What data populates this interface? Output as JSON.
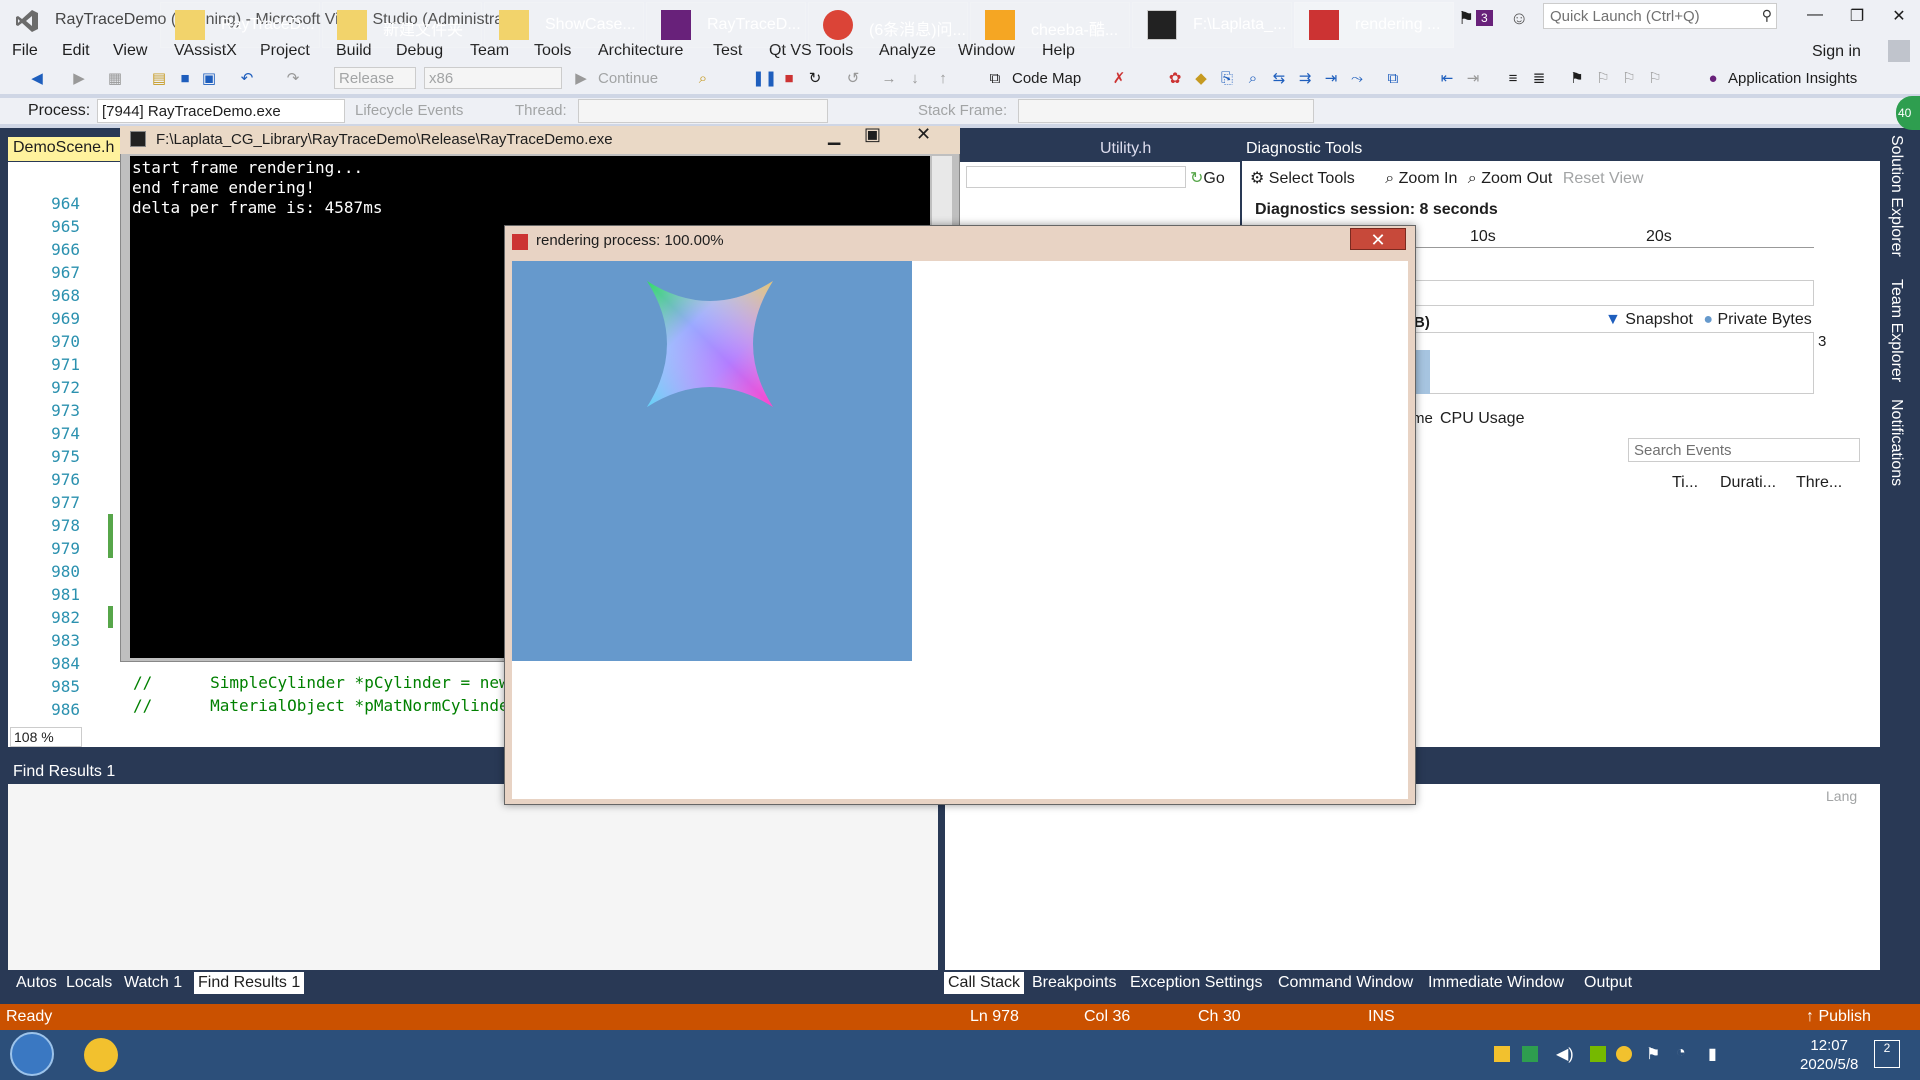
{
  "window": {
    "title": "RayTraceDemo (Running) - Microsoft Visual Studio (Administrator)",
    "notification_count": "3",
    "quick_launch_placeholder": "Quick Launch (Ctrl+Q)",
    "sign_in": "Sign in"
  },
  "menu": [
    "File",
    "Edit",
    "View",
    "VAssistX",
    "Project",
    "Build",
    "Debug",
    "Team",
    "Tools",
    "Architecture",
    "Test",
    "Qt VS Tools",
    "Analyze",
    "Window",
    "Help"
  ],
  "toolbar": {
    "config": "Release",
    "platform": "x86",
    "continue": "Continue",
    "code_map": "Code Map",
    "app_insights": "Application Insights"
  },
  "debugbar": {
    "process_label": "Process:",
    "process_value": "[7944] RayTraceDemo.exe",
    "lifecycle": "Lifecycle Events",
    "thread_label": "Thread:",
    "stack_frame": "Stack Frame:"
  },
  "editor": {
    "tab": "DemoScene.h",
    "utility_tab": "Utility.h",
    "go": "Go",
    "zoom": "108 %",
    "line_numbers": [
      "964",
      "965",
      "966",
      "967",
      "968",
      "969",
      "970",
      "971",
      "972",
      "973",
      "974",
      "975",
      "976",
      "977",
      "978",
      "979",
      "980",
      "981",
      "982",
      "983",
      "984",
      "985",
      "986"
    ],
    "code_985": "//      SimpleCylinder *pCylinder = new",
    "code_986": "//      MaterialObject *pMatNormCylinde"
  },
  "diagnostics": {
    "title": "Diagnostic Tools",
    "select_tools": "Select Tools",
    "zoom_in": "Zoom In",
    "zoom_out": "Zoom Out",
    "reset_view": "Reset View",
    "session": "Diagnostics session: 8 seconds",
    "tick_10": "10s",
    "tick_20": "20s",
    "partial_b": "B)",
    "snapshot": "Snapshot",
    "private_bytes": "Private Bytes",
    "value_3": "3",
    "partial_me": "me",
    "cpu_usage": "CPU Usage",
    "search_events": "Search Events",
    "col_time": "Ti...",
    "col_duration": "Durati...",
    "col_thread": "Thre...",
    "lang": "Lang"
  },
  "side_tabs": [
    "Solution Explorer",
    "Team Explorer",
    "Notifications"
  ],
  "find_results": {
    "title": "Find Results 1"
  },
  "bottom_tabs_left": [
    "Autos",
    "Locals",
    "Watch 1",
    "Find Results 1"
  ],
  "bottom_tabs_right": [
    "Call Stack",
    "Breakpoints",
    "Exception Settings",
    "Command Window",
    "Immediate Window",
    "Output"
  ],
  "status": {
    "ready": "Ready",
    "ln": "Ln 978",
    "col": "Col 36",
    "ch": "Ch 30",
    "ins": "INS",
    "publish": "Publish"
  },
  "console": {
    "title": "F:\\Laplata_CG_Library\\RayTraceDemo\\Release\\RayTraceDemo.exe",
    "lines": [
      "start frame rendering...",
      "end frame endering!",
      "delta per frame is: 4587ms"
    ]
  },
  "render_window": {
    "title": "rendering process: 100.00%"
  },
  "taskbar": {
    "items": [
      "RayTraceD...",
      "新建文件夹",
      "ShowCase...",
      "RayTraceD...",
      "(6条消息)问...",
      "cheeba-酷...",
      "F:\\Laplata_...",
      "rendering ..."
    ],
    "time": "12:07",
    "date": "2020/5/8",
    "badge": "40"
  },
  "colors": {
    "accent_purple": "#68217a",
    "frame_blue": "#293955",
    "status_orange": "#ca5100",
    "canvas_blue": "#6699cc"
  }
}
